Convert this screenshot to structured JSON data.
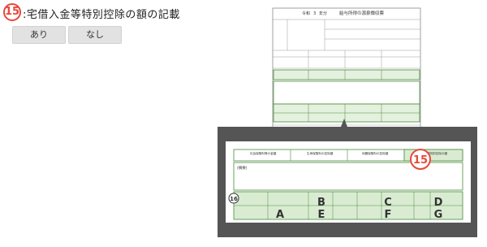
{
  "question": {
    "number": "15",
    "title": ":宅借入金等特別控除の額の記載"
  },
  "options": [
    {
      "label": "あり"
    },
    {
      "label": "なし"
    }
  ],
  "document": {
    "era_label": "令和",
    "year": "3",
    "year_suffix": "年分",
    "title": "給与所得の源泉徴収票"
  },
  "zoom": {
    "headers": [
      "社会保険料等の金額",
      "生命保険料の控除額",
      "地震保険料の控除額",
      "住宅借入金等特別控除の額"
    ],
    "remarks_label": "(摘要)",
    "badge_15": "15",
    "badge_16": "16",
    "letters": [
      "A",
      "B",
      "C",
      "D",
      "E",
      "F",
      "G"
    ]
  },
  "colors": {
    "badge": "#e8483b",
    "zoom_frame": "#555555",
    "form_green": "#4a8a3a",
    "highlight": "#d9ecd2"
  }
}
